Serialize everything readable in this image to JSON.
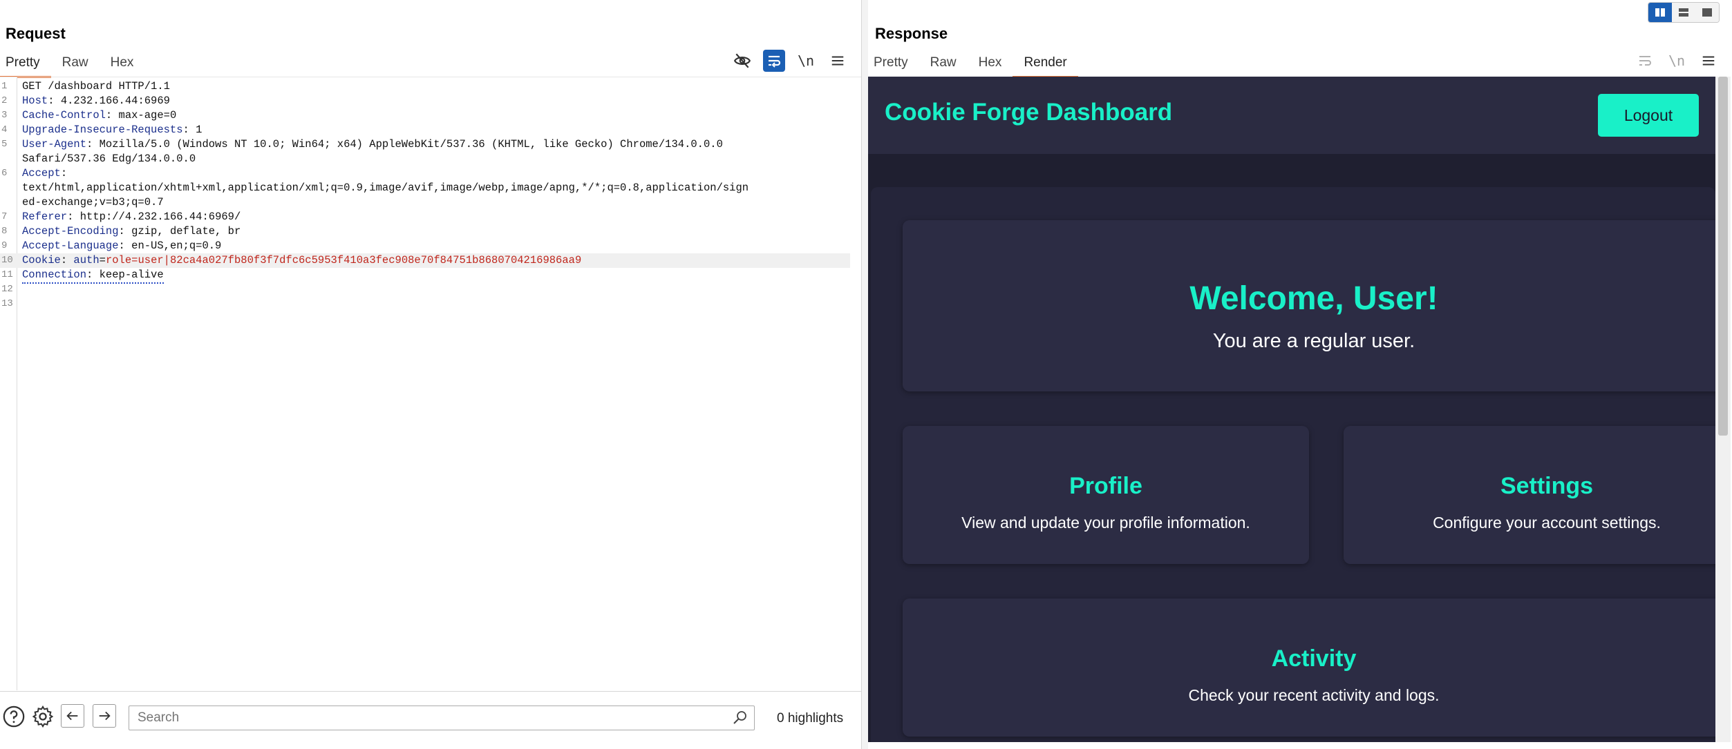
{
  "request": {
    "title": "Request",
    "tabs": [
      {
        "label": "Pretty",
        "active": true
      },
      {
        "label": "Raw",
        "active": false
      },
      {
        "label": "Hex",
        "active": false
      }
    ],
    "toolbar": {
      "newline_label": "\\n"
    },
    "lines": [
      {
        "n": "1",
        "key": "",
        "sep": "",
        "value": "GET /dashboard HTTP/1.1"
      },
      {
        "n": "2",
        "key": "Host",
        "sep": ": ",
        "value": "4.232.166.44:6969"
      },
      {
        "n": "3",
        "key": "Cache-Control",
        "sep": ": ",
        "value": "max-age=0"
      },
      {
        "n": "4",
        "key": "Upgrade-Insecure-Requests",
        "sep": ": ",
        "value": "1"
      },
      {
        "n": "5",
        "key": "User-Agent",
        "sep": ": ",
        "value": "Mozilla/5.0 (Windows NT 10.0; Win64; x64) AppleWebKit/537.36 (KHTML, like Gecko) Chrome/134.0.0.0"
      },
      {
        "n": "",
        "key": "",
        "sep": "",
        "value": "Safari/537.36 Edg/134.0.0.0"
      },
      {
        "n": "6",
        "key": "Accept",
        "sep": ":",
        "value": ""
      },
      {
        "n": "",
        "key": "",
        "sep": "",
        "value": "text/html,application/xhtml+xml,application/xml;q=0.9,image/avif,image/webp,image/apng,*/*;q=0.8,application/sign"
      },
      {
        "n": "",
        "key": "",
        "sep": "",
        "value": "ed-exchange;v=b3;q=0.7"
      },
      {
        "n": "7",
        "key": "Referer",
        "sep": ": ",
        "value": "http://4.232.166.44:6969/"
      },
      {
        "n": "8",
        "key": "Accept-Encoding",
        "sep": ": ",
        "value": "gzip, deflate, br"
      },
      {
        "n": "9",
        "key": "Accept-Language",
        "sep": ": ",
        "value": "en-US,en;q=0.9"
      }
    ],
    "cookie_line": {
      "n": "10",
      "key": "Cookie",
      "sep": ": ",
      "cookie_name": "auth",
      "eq": "=",
      "cookie_value": "role=user|82ca4a027fb80f3f7dfc6c5953f410a3fec908e70f84751b8680704216986aa9"
    },
    "connection_line": {
      "n": "11",
      "key": "Connection",
      "sep": ": ",
      "value": "keep-alive"
    },
    "empty_lines": [
      "12",
      "13"
    ],
    "search": {
      "placeholder": "Search",
      "value": ""
    },
    "highlights": "0 highlights"
  },
  "response": {
    "title": "Response",
    "tabs": [
      {
        "label": "Pretty",
        "active": false
      },
      {
        "label": "Raw",
        "active": false
      },
      {
        "label": "Hex",
        "active": false
      },
      {
        "label": "Render",
        "active": true
      }
    ],
    "toolbar": {
      "newline_label": "\\n"
    },
    "render": {
      "brand": "Cookie Forge Dashboard",
      "logout": "Logout",
      "welcome_title": "Welcome, User!",
      "welcome_text": "You are a regular user.",
      "cards": [
        {
          "title": "Profile",
          "text": "View and update your profile information."
        },
        {
          "title": "Settings",
          "text": "Configure your account settings."
        },
        {
          "title": "Activity",
          "text": "Check your recent activity and logs."
        }
      ],
      "colors": {
        "accent": "#19f0c8",
        "bg": "#1f1f30",
        "card": "#2c2c44",
        "nav": "#2b2b41"
      }
    }
  }
}
